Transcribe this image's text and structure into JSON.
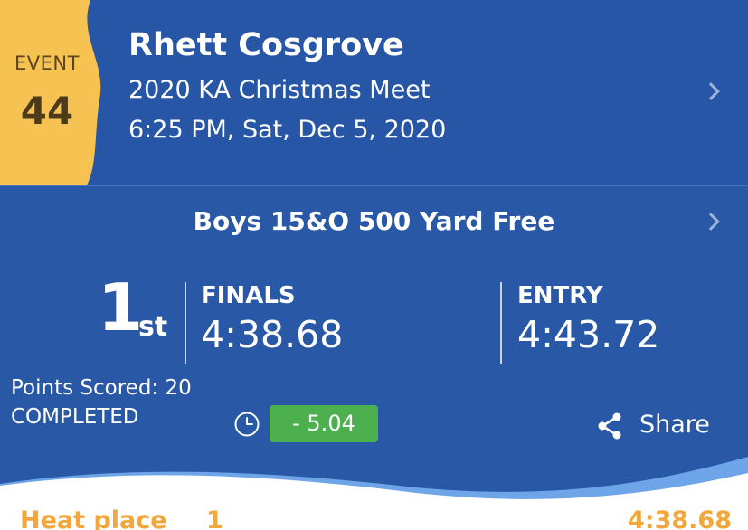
{
  "colors": {
    "header_bg": "#2856a6",
    "badge_yellow": "#f6c251",
    "accent_green": "#4cb04f",
    "accent_orange": "#f2a63b"
  },
  "event": {
    "label": "EVENT",
    "number": "44"
  },
  "swimmer": {
    "name": "Rhett Cosgrove"
  },
  "meet": {
    "name": "2020 KA Christmas Meet",
    "datetime": "6:25 PM, Sat, Dec 5, 2020"
  },
  "race": {
    "title": "Boys 15&O 500 Yard Free",
    "place": "1",
    "place_suffix": "st",
    "finals_label": "FINALS",
    "finals_time": "4:38.68",
    "entry_label": "ENTRY",
    "entry_time": "4:43.72",
    "points_scored": "Points Scored: 20",
    "status": "COMPLETED",
    "time_diff": "- 5.04"
  },
  "actions": {
    "share_label": "Share"
  },
  "icons": {
    "chevron": "chevron-right-icon",
    "clock": "clock-icon",
    "share": "share-icon"
  },
  "heat": {
    "label": "Heat place",
    "place": "1",
    "time": "4:38.68"
  }
}
